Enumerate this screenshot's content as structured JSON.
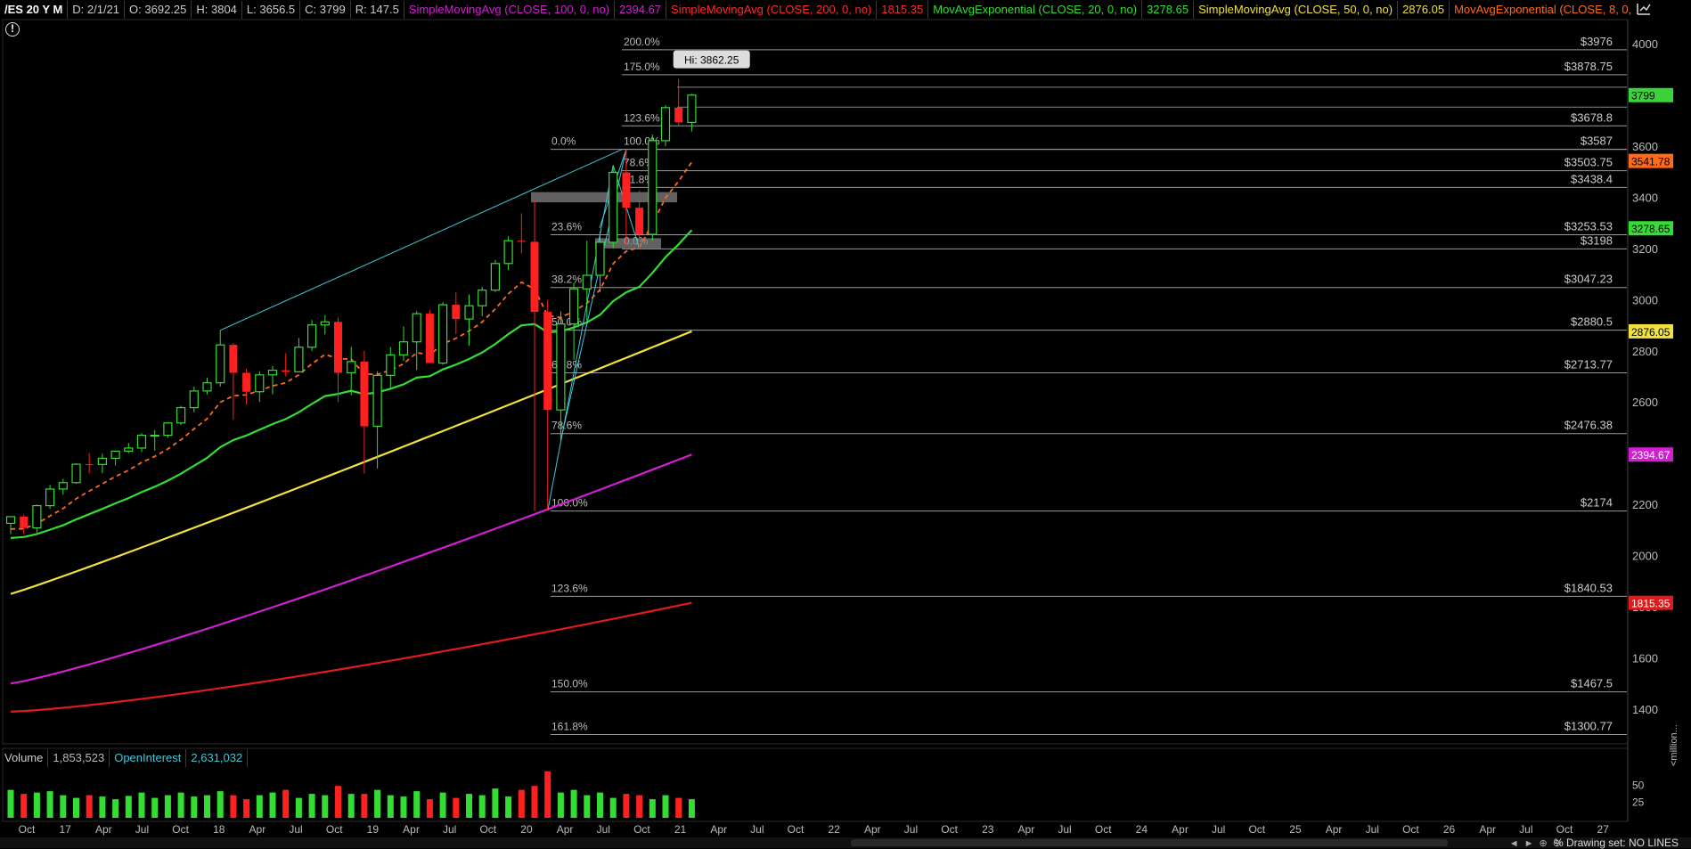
{
  "header": {
    "symbol": "/ES 20 Y M",
    "date": "D: 2/1/21",
    "open": "O: 3692.25",
    "high": "H: 3804",
    "low": "L: 3656.5",
    "close": "C: 3799",
    "range": "R: 147.5",
    "studies": [
      {
        "label": "SimpleMovingAvg (CLOSE, 100, 0, no)",
        "value": "2394.67",
        "color": "#d21fd2"
      },
      {
        "label": "SimpleMovingAvg (CLOSE, 200, 0, no)",
        "value": "1815.35",
        "color": "#ff2a2a"
      },
      {
        "label": "MovAvgExponential (CLOSE, 20, 0, no)",
        "value": "3278.65",
        "color": "#33dd33"
      },
      {
        "label": "SimpleMovingAvg (CLOSE, 50, 0, no)",
        "value": "2876.05",
        "color": "#f0e040"
      },
      {
        "label": "MovAvgExponential (CLOSE, 8, 0, no)",
        "value": "",
        "color": "#ff6a1a"
      }
    ]
  },
  "alert_icon": "exclamation-icon",
  "chart_data": {
    "type": "candlestick",
    "timeframe": "monthly",
    "x_tick_labels": [
      "Oct",
      "17",
      "Apr",
      "Jul",
      "Oct",
      "18",
      "Apr",
      "Jul",
      "Oct",
      "19",
      "Apr",
      "Jul",
      "Oct",
      "20",
      "Apr",
      "Jul",
      "Oct",
      "21",
      "Apr",
      "Jul",
      "Oct",
      "22",
      "Apr",
      "Jul",
      "Oct",
      "23",
      "Apr",
      "Jul",
      "Oct",
      "24",
      "Apr",
      "Jul",
      "Oct",
      "25",
      "Apr",
      "Jul",
      "Oct",
      "26",
      "Apr",
      "Jul",
      "Oct",
      "27"
    ],
    "y_ticks": [
      1400,
      1600,
      1800,
      2000,
      2200,
      2400,
      2600,
      2800,
      3000,
      3200,
      3400,
      3600,
      3800,
      4000
    ],
    "ylim": [
      1300,
      4050
    ],
    "high_annotation": "Hi: 3862.25",
    "candles": [
      {
        "o": 2126,
        "h": 2150,
        "l": 2084,
        "c": 2152
      },
      {
        "o": 2152,
        "h": 2160,
        "l": 2085,
        "c": 2108
      },
      {
        "o": 2108,
        "h": 2200,
        "l": 2090,
        "c": 2195
      },
      {
        "o": 2195,
        "h": 2276,
        "l": 2183,
        "c": 2260
      },
      {
        "o": 2260,
        "h": 2300,
        "l": 2238,
        "c": 2285
      },
      {
        "o": 2285,
        "h": 2360,
        "l": 2280,
        "c": 2357
      },
      {
        "o": 2357,
        "h": 2400,
        "l": 2322,
        "c": 2356
      },
      {
        "o": 2356,
        "h": 2398,
        "l": 2322,
        "c": 2380
      },
      {
        "o": 2380,
        "h": 2410,
        "l": 2352,
        "c": 2408
      },
      {
        "o": 2408,
        "h": 2440,
        "l": 2400,
        "c": 2420
      },
      {
        "o": 2420,
        "h": 2478,
        "l": 2405,
        "c": 2470
      },
      {
        "o": 2470,
        "h": 2490,
        "l": 2410,
        "c": 2470
      },
      {
        "o": 2470,
        "h": 2520,
        "l": 2460,
        "c": 2518
      },
      {
        "o": 2518,
        "h": 2585,
        "l": 2510,
        "c": 2578
      },
      {
        "o": 2578,
        "h": 2660,
        "l": 2560,
        "c": 2643
      },
      {
        "o": 2643,
        "h": 2695,
        "l": 2630,
        "c": 2675
      },
      {
        "o": 2675,
        "h": 2880,
        "l": 2660,
        "c": 2823
      },
      {
        "o": 2823,
        "h": 2830,
        "l": 2530,
        "c": 2714
      },
      {
        "o": 2714,
        "h": 2730,
        "l": 2590,
        "c": 2640
      },
      {
        "o": 2640,
        "h": 2720,
        "l": 2600,
        "c": 2706
      },
      {
        "o": 2706,
        "h": 2740,
        "l": 2630,
        "c": 2724
      },
      {
        "o": 2724,
        "h": 2790,
        "l": 2700,
        "c": 2718
      },
      {
        "o": 2718,
        "h": 2850,
        "l": 2720,
        "c": 2814
      },
      {
        "o": 2814,
        "h": 2920,
        "l": 2800,
        "c": 2901
      },
      {
        "o": 2901,
        "h": 2940,
        "l": 2864,
        "c": 2913
      },
      {
        "o": 2913,
        "h": 2930,
        "l": 2600,
        "c": 2714
      },
      {
        "o": 2714,
        "h": 2815,
        "l": 2626,
        "c": 2758
      },
      {
        "o": 2758,
        "h": 2800,
        "l": 2320,
        "c": 2505
      },
      {
        "o": 2505,
        "h": 2720,
        "l": 2340,
        "c": 2704
      },
      {
        "o": 2704,
        "h": 2815,
        "l": 2650,
        "c": 2784
      },
      {
        "o": 2784,
        "h": 2895,
        "l": 2760,
        "c": 2835
      },
      {
        "o": 2835,
        "h": 2955,
        "l": 2725,
        "c": 2945
      },
      {
        "o": 2945,
        "h": 2960,
        "l": 2800,
        "c": 2752
      },
      {
        "o": 2752,
        "h": 2990,
        "l": 2745,
        "c": 2980
      },
      {
        "o": 2980,
        "h": 3028,
        "l": 2865,
        "c": 2924
      },
      {
        "o": 2924,
        "h": 3020,
        "l": 2820,
        "c": 2976
      },
      {
        "o": 2976,
        "h": 3050,
        "l": 2935,
        "c": 3037
      },
      {
        "o": 3037,
        "h": 3155,
        "l": 3030,
        "c": 3141
      },
      {
        "o": 3141,
        "h": 3247,
        "l": 3115,
        "c": 3230
      },
      {
        "o": 3230,
        "h": 3337,
        "l": 3180,
        "c": 3226
      },
      {
        "o": 3226,
        "h": 3393,
        "l": 2175,
        "c": 2952
      },
      {
        "o": 2952,
        "h": 3000,
        "l": 2174,
        "c": 2569
      },
      {
        "o": 2569,
        "h": 2955,
        "l": 2450,
        "c": 2905
      },
      {
        "o": 2905,
        "h": 3065,
        "l": 2765,
        "c": 3042
      },
      {
        "o": 3042,
        "h": 3230,
        "l": 2915,
        "c": 3095
      },
      {
        "o": 3095,
        "h": 3265,
        "l": 3030,
        "c": 3224
      },
      {
        "o": 3224,
        "h": 3525,
        "l": 3200,
        "c": 3497
      },
      {
        "o": 3497,
        "h": 3587,
        "l": 3210,
        "c": 3359
      },
      {
        "o": 3359,
        "h": 3425,
        "l": 3200,
        "c": 3255
      },
      {
        "o": 3255,
        "h": 3645,
        "l": 3230,
        "c": 3621
      },
      {
        "o": 3621,
        "h": 3760,
        "l": 3600,
        "c": 3750
      },
      {
        "o": 3750,
        "h": 3862.25,
        "l": 3680,
        "c": 3692.25
      },
      {
        "o": 3692.25,
        "h": 3804,
        "l": 3656.5,
        "c": 3799
      }
    ],
    "fib_levels": [
      {
        "pct": "200.0%",
        "price": 3976,
        "label": "$3976",
        "set": "upper"
      },
      {
        "pct": "175.0%",
        "price": 3878.75,
        "label": "$3878.75",
        "set": "upper"
      },
      {
        "pct": "123.6%",
        "price": 3678.8,
        "label": "$3678.8",
        "set": "upper"
      },
      {
        "pct": "100.0%",
        "price": 3587,
        "label": "$3587",
        "set": "upper"
      },
      {
        "pct": "78.6%",
        "price": 3503.75,
        "label": "$3503.75",
        "set": "upper"
      },
      {
        "pct": "61.8%",
        "price": 3438.4,
        "label": "$3438.4",
        "set": "upper"
      },
      {
        "pct": "0.0%",
        "price": 3198,
        "label": "$3198",
        "set": "upper"
      },
      {
        "pct": "0.0%",
        "price": 3587,
        "label": "",
        "set": "lower"
      },
      {
        "pct": "23.6%",
        "price": 3253.53,
        "label": "$3253.53",
        "set": "lower"
      },
      {
        "pct": "38.2%",
        "price": 3047.23,
        "label": "$3047.23",
        "set": "lower"
      },
      {
        "pct": "50.0%",
        "price": 2880.5,
        "label": "$2880.5",
        "set": "lower"
      },
      {
        "pct": "61.8%",
        "price": 2713.77,
        "label": "$2713.77",
        "set": "lower"
      },
      {
        "pct": "78.6%",
        "price": 2476.38,
        "label": "$2476.38",
        "set": "lower"
      },
      {
        "pct": "100.0%",
        "price": 2174,
        "label": "$2174",
        "set": "lower"
      },
      {
        "pct": "123.6%",
        "price": 1840.53,
        "label": "$1840.53",
        "set": "lower"
      },
      {
        "pct": "150.0%",
        "price": 1467.5,
        "label": "$1467.5",
        "set": "lower"
      },
      {
        "pct": "161.8%",
        "price": 1300.77,
        "label": "$1300.77",
        "set": "lower"
      }
    ],
    "price_tags": [
      {
        "value": 3799,
        "label": "3799",
        "color": "#3cd23c",
        "text": "#000"
      },
      {
        "value": 3541.78,
        "label": "3541.78",
        "color": "#ff6a1a",
        "text": "#000"
      },
      {
        "value": 3278.65,
        "label": "3278.65",
        "color": "#33dd33",
        "text": "#000"
      },
      {
        "value": 2876.05,
        "label": "2876.05",
        "color": "#f0e040",
        "text": "#000"
      },
      {
        "value": 2394.67,
        "label": "2394.67",
        "color": "#d21fd2",
        "text": "#fff"
      },
      {
        "value": 1815.35,
        "label": "1815.35",
        "color": "#e01b1b",
        "text": "#fff"
      }
    ],
    "volume": {
      "label": "Volume",
      "volume_value": "1,853,523",
      "oi_label": "OpenInterest",
      "oi_value": "2,631,032",
      "axis_ticks": [
        50,
        25
      ],
      "axis_unit": "<million...",
      "ylim": [
        0,
        75
      ],
      "values": [
        42,
        36,
        38,
        40,
        34,
        30,
        34,
        32,
        28,
        33,
        38,
        30,
        34,
        38,
        32,
        34,
        40,
        34,
        28,
        34,
        38,
        42,
        30,
        36,
        34,
        48,
        36,
        36,
        42,
        34,
        32,
        40,
        28,
        38,
        30,
        36,
        34,
        44,
        32,
        42,
        48,
        70,
        38,
        42,
        34,
        38,
        30,
        36,
        34,
        28,
        34,
        30,
        28
      ]
    },
    "colors": {
      "up": "#33dd33",
      "down": "#ff2020",
      "ema20": "#33dd33",
      "sma50": "#f0e040",
      "sma100": "#d21fd2",
      "sma200": "#e01b1b",
      "ema8": "#ff6a1a",
      "fib": "#9a9a9a",
      "trend": "#3ec8d8"
    }
  },
  "footer": {
    "drawing_set": "Drawing set: NO LINES",
    "zoom_label": "%"
  }
}
